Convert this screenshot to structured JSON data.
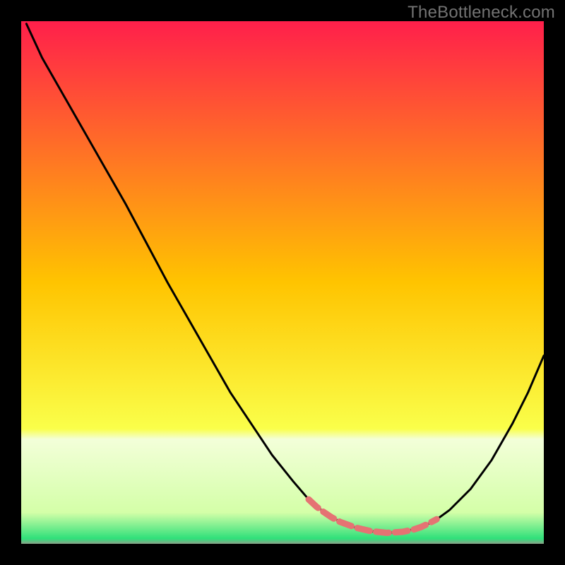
{
  "watermark": {
    "text": "TheBottleneck.com"
  },
  "chart_data": {
    "type": "line",
    "title": "",
    "xlabel": "",
    "ylabel": "",
    "xlim": [
      0,
      100
    ],
    "ylim": [
      0,
      100
    ],
    "grid": false,
    "legend": "none",
    "background_gradient": {
      "stops": [
        {
          "offset": 0.0,
          "color": "#ff1f4b"
        },
        {
          "offset": 0.5,
          "color": "#ffc400"
        },
        {
          "offset": 0.78,
          "color": "#faff4a"
        },
        {
          "offset": 0.8,
          "color": "#f3ffd9"
        },
        {
          "offset": 0.94,
          "color": "#d4ffa8"
        },
        {
          "offset": 0.99,
          "color": "#2fe07a"
        },
        {
          "offset": 1.0,
          "color": "#8aa38a"
        }
      ]
    },
    "series": [
      {
        "name": "bottleneck-curve",
        "stroke": "#000000",
        "x": [
          1,
          4,
          8,
          12,
          16,
          20,
          24,
          28,
          32,
          36,
          40,
          44,
          48,
          52,
          55,
          58,
          61,
          64,
          67,
          70,
          73,
          76,
          79,
          82,
          86,
          90,
          94,
          97,
          100
        ],
        "y": [
          99.5,
          93,
          86,
          79,
          72,
          65,
          57.5,
          50,
          43,
          36,
          29,
          23,
          17,
          12,
          8.5,
          6,
          4.2,
          3.1,
          2.4,
          2.1,
          2.3,
          3.0,
          4.3,
          6.5,
          10.5,
          16,
          23,
          29,
          36
        ]
      },
      {
        "name": "optimal-range-overlay",
        "stroke": "#e57373",
        "stroke_width": 9,
        "x": [
          55,
          56.5,
          58,
          59.5,
          61,
          64,
          67,
          70,
          73,
          75,
          76.5,
          78,
          79.5
        ],
        "y": [
          8.5,
          7.1,
          6.0,
          5.0,
          4.2,
          3.1,
          2.4,
          2.1,
          2.3,
          2.7,
          3.2,
          3.9,
          4.7
        ]
      }
    ]
  }
}
